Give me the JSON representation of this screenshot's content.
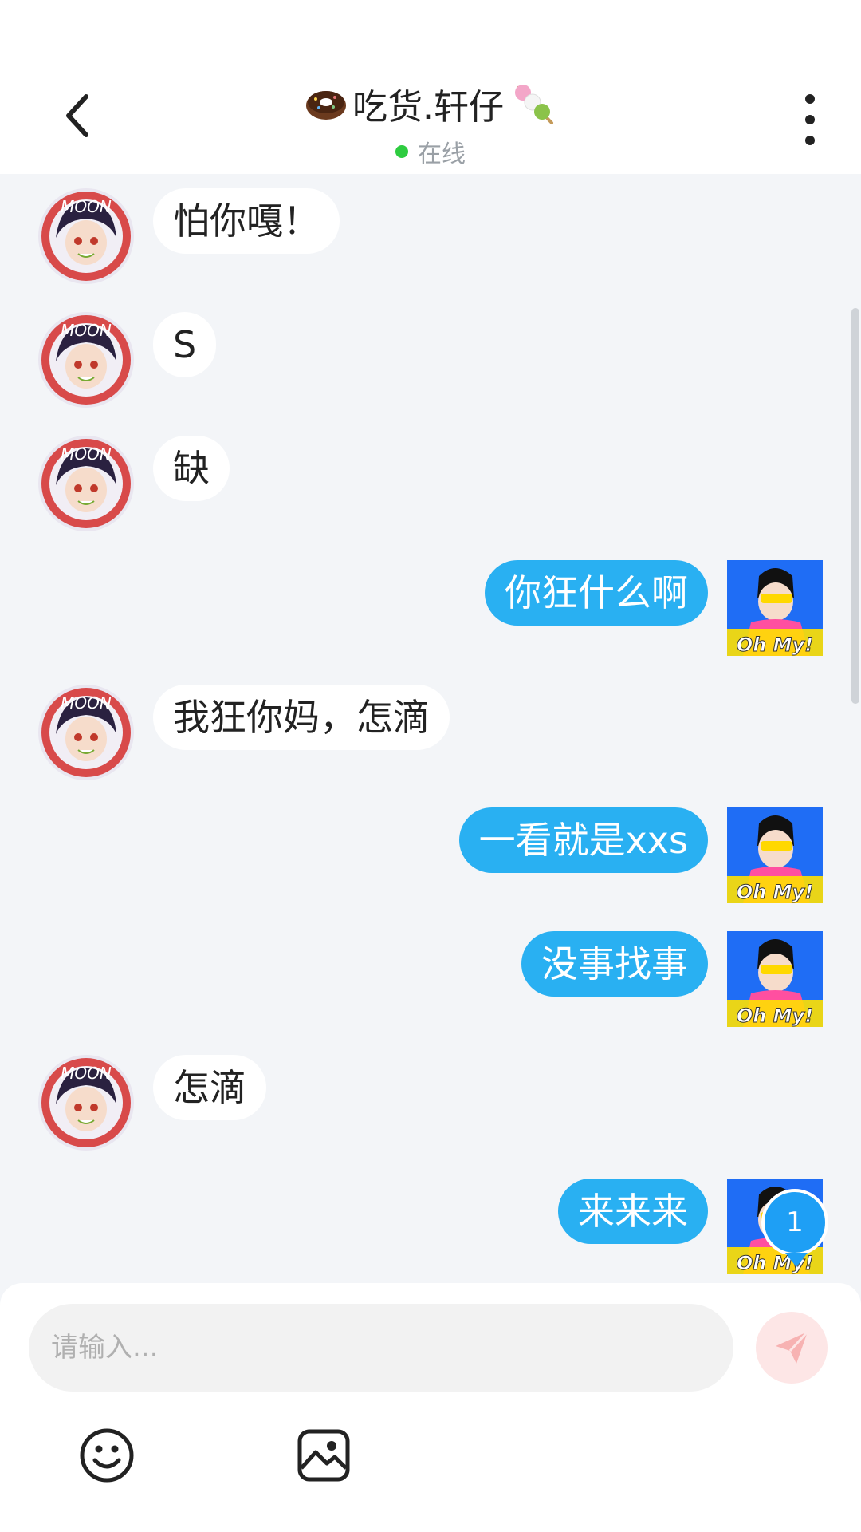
{
  "header": {
    "title": "吃货.轩仔",
    "status": "在线",
    "status_color": "#2ecc40",
    "back_icon": "chevron-left-icon",
    "menu_icon": "more-vertical-icon",
    "title_left_icon": "donut-emoji",
    "title_right_icon": "dango-emoji"
  },
  "messages": [
    {
      "side": "in",
      "text": "怕你嘎！"
    },
    {
      "side": "in",
      "text": "S"
    },
    {
      "side": "in",
      "text": "缺"
    },
    {
      "side": "out",
      "text": "你狂什么啊"
    },
    {
      "side": "in",
      "text": "我狂你妈，怎滴"
    },
    {
      "side": "out",
      "text": "一看就是xxs"
    },
    {
      "side": "out",
      "text": "没事找事"
    },
    {
      "side": "in",
      "text": "怎滴"
    },
    {
      "side": "out",
      "text": "来来来"
    }
  ],
  "my_avatar_text": "Oh My!",
  "their_avatar_text": "MOON",
  "unread_badge": "1",
  "composer": {
    "placeholder": "请输入...",
    "send_icon": "paper-plane-icon",
    "emoji_icon": "smiley-icon",
    "image_icon": "image-icon"
  },
  "colors": {
    "outgoing_bubble": "#29b0f2",
    "incoming_bubble": "#ffffff",
    "background": "#f3f5f8",
    "badge": "#1e9ff5"
  }
}
